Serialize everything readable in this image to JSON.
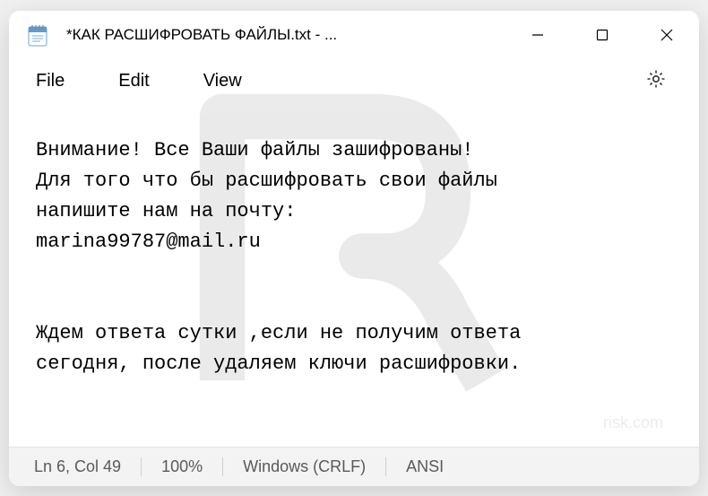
{
  "window": {
    "title": "*КАК РАСШИФРОВАТЬ ФАЙЛЫ.txt - ..."
  },
  "menu": {
    "file": "File",
    "edit": "Edit",
    "view": "View"
  },
  "content": {
    "text": "Внимание! Все Ваши файлы зашифрованы!\nДля того что бы расшифровать свои файлы\nнапишите нам на почту:\nmarina99787@mail.ru\n\n\nЖдем ответа сутки ,если не получим ответа\nсегодня, после удаляем ключи расшифровки."
  },
  "statusbar": {
    "position": "Ln 6, Col 49",
    "zoom": "100%",
    "line_ending": "Windows (CRLF)",
    "encoding": "ANSI"
  },
  "watermark": {
    "text": "risk.com"
  }
}
